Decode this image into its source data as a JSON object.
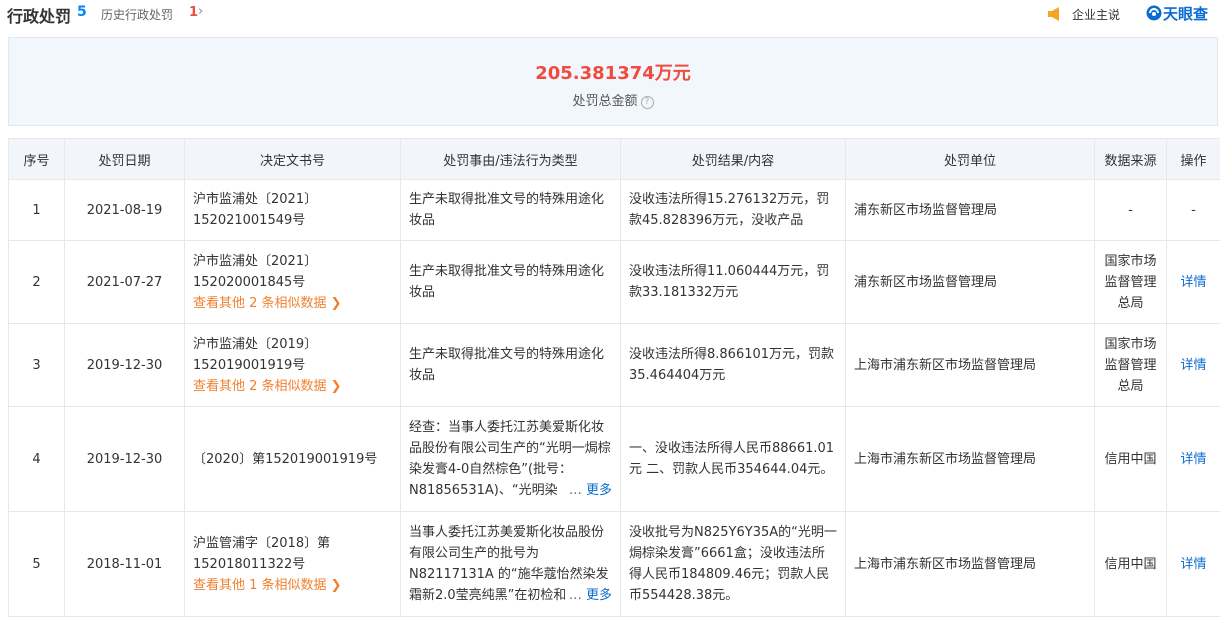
{
  "header": {
    "title": "行政处罚",
    "count": "5",
    "history_label": "历史行政处罚",
    "history_count": "1",
    "history_arrow": "›",
    "owner_label": "企业主说",
    "brand": "天眼查"
  },
  "summary": {
    "amount": "205.381374万元",
    "label": "处罚总金额",
    "help": "?"
  },
  "table": {
    "columns": [
      "序号",
      "处罚日期",
      "决定文书号",
      "处罚事由/违法行为类型",
      "处罚结果/内容",
      "处罚单位",
      "数据来源",
      "操作"
    ],
    "rows": [
      {
        "no": "1",
        "date": "2021-08-19",
        "doc": "沪市监浦处〔2021〕152021001549号",
        "more": "",
        "reason": "生产未取得批准文号的特殊用途化妆品",
        "result": "没收违法所得15.276132万元，罚款45.828396万元，没收产品",
        "unit": "浦东新区市场监督管理局",
        "source": "-",
        "action": "-"
      },
      {
        "no": "2",
        "date": "2021-07-27",
        "doc": "沪市监浦处〔2021〕152020001845号",
        "more": "查看其他 2 条相似数据 ❯",
        "reason": "生产未取得批准文号的特殊用途化妆品",
        "result": "没收违法所得11.060444万元，罚款33.181332万元",
        "unit": "浦东新区市场监督管理局",
        "source": "国家市场监督管理总局",
        "action": "详情"
      },
      {
        "no": "3",
        "date": "2019-12-30",
        "doc": "沪市监浦处〔2019〕152019001919号",
        "more": "查看其他 2 条相似数据 ❯",
        "reason": "生产未取得批准文号的特殊用途化妆品",
        "result": "没收违法所得8.866101万元，罚款35.464404万元",
        "unit": "上海市浦东新区市场监督管理局",
        "source": "国家市场监督管理总局",
        "action": "详情"
      },
      {
        "no": "4",
        "date": "2019-12-30",
        "doc": "〔2020〕第152019001919号",
        "more": "",
        "reason": "经查：当事人委托江苏美爱斯化妆品股份有限公司生产的“光明一焗棕染发膏4-0自然棕色”(批号：N81856531A)、“光明染",
        "reason_more": "更多",
        "result": "一、没收违法所得人民币88661.01元 二、罚款人民币354644.04元。",
        "unit": "上海市浦东新区市场监督管理局",
        "source": "信用中国",
        "action": "详情"
      },
      {
        "no": "5",
        "date": "2018-11-01",
        "doc": "沪监管浦字〔2018〕第152018011322号",
        "more": "查看其他 1 条相似数据 ❯",
        "reason": "当事人委托江苏美爱斯化妆品股份有限公司生产的批号为N82117131A 的“施华蔻怡然染发霜新2.0莹亮纯黑”在初检和复检",
        "reason_more": "更多",
        "result": "没收批号为N825Y6Y35A的“光明一焗棕染发膏”6661盒；没收违法所得人民币184809.46元；罚款人民币554428.38元。",
        "unit": "上海市浦东新区市场监督管理局",
        "source": "信用中国",
        "action": "详情"
      }
    ]
  },
  "colors": {
    "accent_blue": "#0a6dd1",
    "amount_red": "#f04b3c",
    "link_orange": "#f08030",
    "header_bg": "#f2f6fb",
    "summary_bg": "#f1f7fd"
  }
}
